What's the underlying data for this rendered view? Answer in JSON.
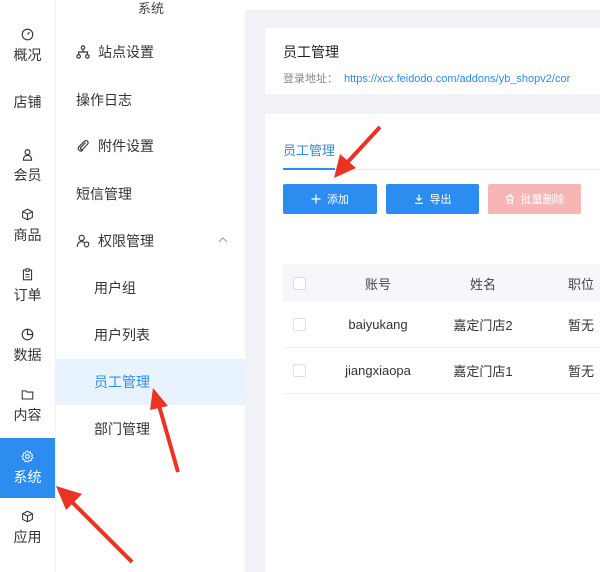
{
  "rail": {
    "items": [
      {
        "label": "概况",
        "icon": "dashboard-icon"
      },
      {
        "label": "店铺",
        "icon": ""
      },
      {
        "label": "会员",
        "icon": "user-icon"
      },
      {
        "label": "商品",
        "icon": "box-icon"
      },
      {
        "label": "订单",
        "icon": "clipboard-icon"
      },
      {
        "label": "数据",
        "icon": "pie-chart-icon"
      },
      {
        "label": "内容",
        "icon": "folder-icon"
      },
      {
        "label": "系统",
        "icon": "gear-icon"
      },
      {
        "label": "应用",
        "icon": "cube-icon"
      }
    ]
  },
  "submenu": {
    "title": "系统",
    "items": [
      {
        "label": "站点设置",
        "icon": "sitemap-icon"
      },
      {
        "label": "操作日志"
      },
      {
        "label": "附件设置",
        "icon": "paperclip-icon"
      },
      {
        "label": "短信管理"
      },
      {
        "label": "权限管理",
        "icon": "user-shield-icon"
      },
      {
        "label": "用户组"
      },
      {
        "label": "用户列表"
      },
      {
        "label": "员工管理"
      },
      {
        "label": "部门管理"
      }
    ]
  },
  "header": {
    "title": "员工管理",
    "addr_label": "登录地址：",
    "addr_url": "https://xcx.feidodo.com/addons/yb_shopv2/cor"
  },
  "tabs": [
    {
      "label": "员工管理"
    }
  ],
  "toolbar": {
    "add_label": "添加",
    "export_label": "导出",
    "delete_label": "批量删除"
  },
  "table": {
    "columns": [
      "账号",
      "姓名",
      "职位"
    ],
    "rows": [
      {
        "account": "baiyukang",
        "name": "嘉定门店2",
        "position": "暂无"
      },
      {
        "account": "jiangxiaopa",
        "name": "嘉定门店1",
        "position": "暂无"
      }
    ]
  },
  "colors": {
    "primary": "#2d8cf0",
    "danger_light": "#f7b5b5",
    "annotation": "#ea3323"
  }
}
